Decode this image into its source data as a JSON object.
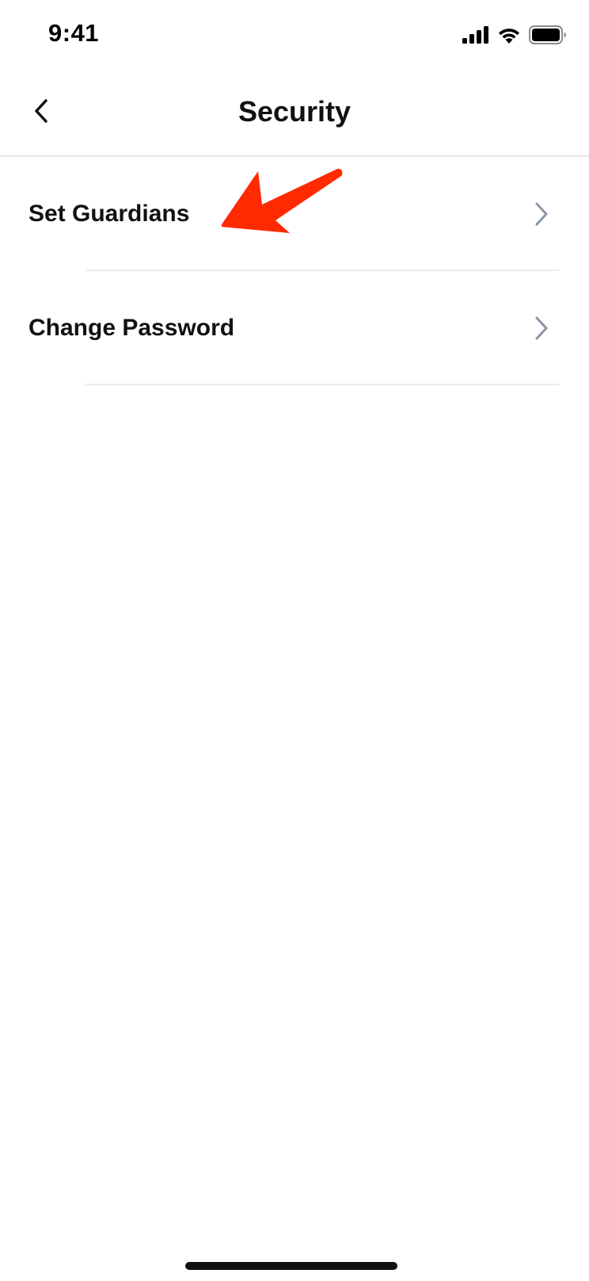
{
  "status_bar": {
    "time": "9:41",
    "icons": [
      "cellular-signal-icon",
      "wifi-icon",
      "battery-icon"
    ]
  },
  "nav": {
    "back_icon": "chevron-left-icon",
    "title": "Security"
  },
  "list": {
    "items": [
      {
        "label": "Set Guardians",
        "icon": "chevron-right-icon"
      },
      {
        "label": "Change Password",
        "icon": "chevron-right-icon"
      }
    ]
  },
  "annotation": {
    "shape": "arrow",
    "color": "#ff2a00",
    "points_to": "Set Guardians"
  },
  "colors": {
    "chevron": "#8a96a8",
    "divider": "#ebebed",
    "text": "#111111"
  }
}
